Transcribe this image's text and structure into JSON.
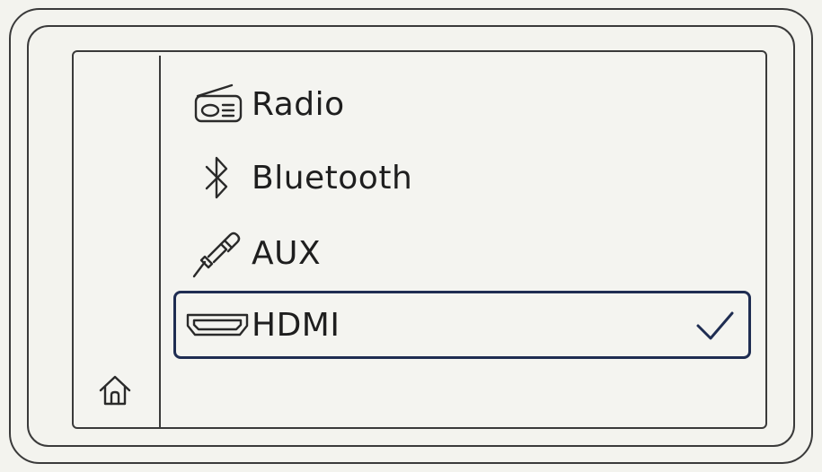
{
  "source_menu": {
    "items": [
      {
        "label": "Radio",
        "icon": "radio-icon",
        "selected": false
      },
      {
        "label": "Bluetooth",
        "icon": "bluetooth-icon",
        "selected": false
      },
      {
        "label": "AUX",
        "icon": "aux-jack-icon",
        "selected": false
      },
      {
        "label": "HDMI",
        "icon": "hdmi-icon",
        "selected": true
      }
    ],
    "selected_marker_icon": "checkmark-icon"
  },
  "sidebar": {
    "home_icon": "home-icon"
  },
  "colors": {
    "selection_border": "#1f2d52",
    "line": "#3a3a3a",
    "background": "#f4f4f0"
  }
}
